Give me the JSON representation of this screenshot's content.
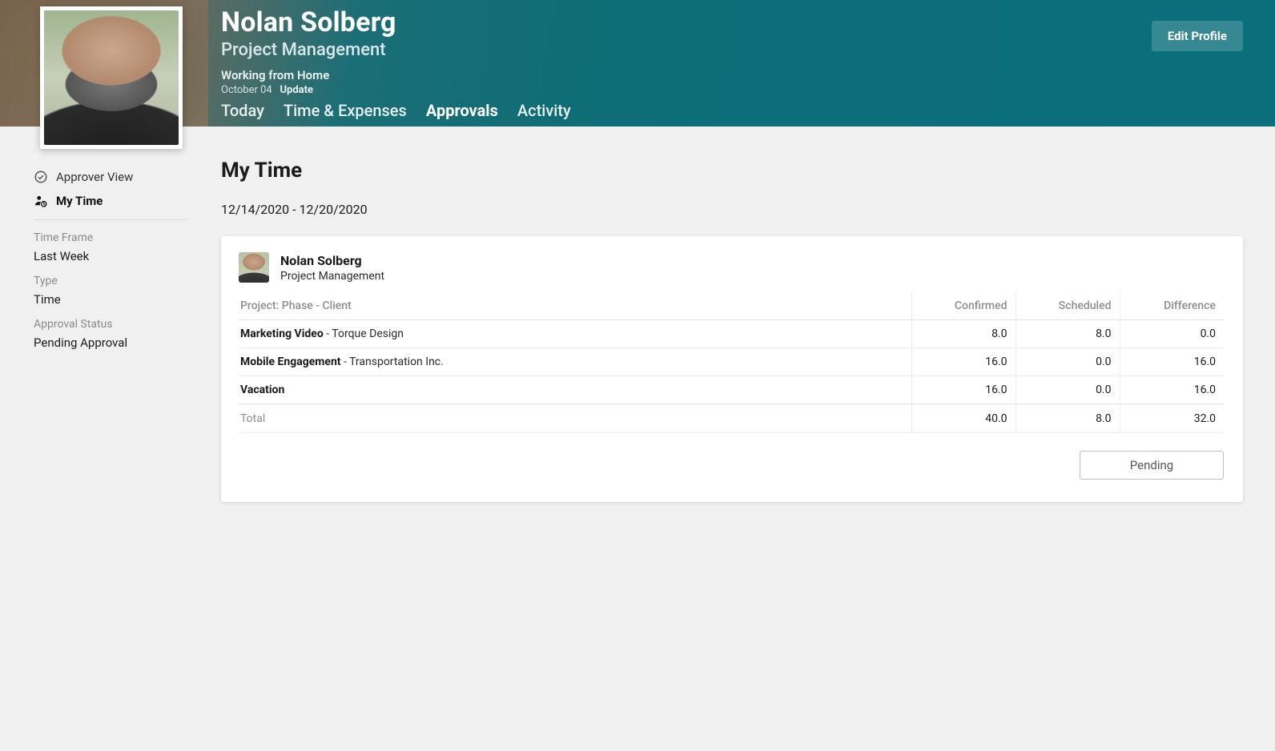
{
  "header": {
    "name": "Nolan Solberg",
    "role": "Project Management",
    "status": "Working from Home",
    "status_date": "October 04",
    "status_action": "Update",
    "edit_label": "Edit Profile",
    "tabs": [
      {
        "label": "Today"
      },
      {
        "label": "Time & Expenses"
      },
      {
        "label": "Approvals"
      },
      {
        "label": "Activity"
      }
    ]
  },
  "sidebar": {
    "approver_view": "Approver View",
    "my_time": "My Time",
    "groups": {
      "time_frame": {
        "label": "Time Frame",
        "value": "Last Week"
      },
      "type": {
        "label": "Type",
        "value": "Time"
      },
      "approval_status": {
        "label": "Approval Status",
        "value": "Pending Approval"
      }
    }
  },
  "main": {
    "title": "My Time",
    "date_range": "12/14/2020 - 12/20/2020"
  },
  "card": {
    "name": "Nolan Solberg",
    "role": "Project Management",
    "columns": {
      "project": "Project: Phase - Client",
      "confirmed": "Confirmed",
      "scheduled": "Scheduled",
      "difference": "Difference"
    },
    "rows": [
      {
        "project": "Marketing Video",
        "client": "Torque Design",
        "confirmed": "8.0",
        "scheduled": "8.0",
        "difference": "0.0"
      },
      {
        "project": "Mobile Engagement",
        "client": "Transportation Inc.",
        "confirmed": "16.0",
        "scheduled": "0.0",
        "difference": "16.0"
      },
      {
        "project": "Vacation",
        "client": "",
        "confirmed": "16.0",
        "scheduled": "0.0",
        "difference": "16.0"
      }
    ],
    "total": {
      "label": "Total",
      "confirmed": "40.0",
      "scheduled": "8.0",
      "difference": "32.0"
    },
    "pending_label": "Pending"
  }
}
